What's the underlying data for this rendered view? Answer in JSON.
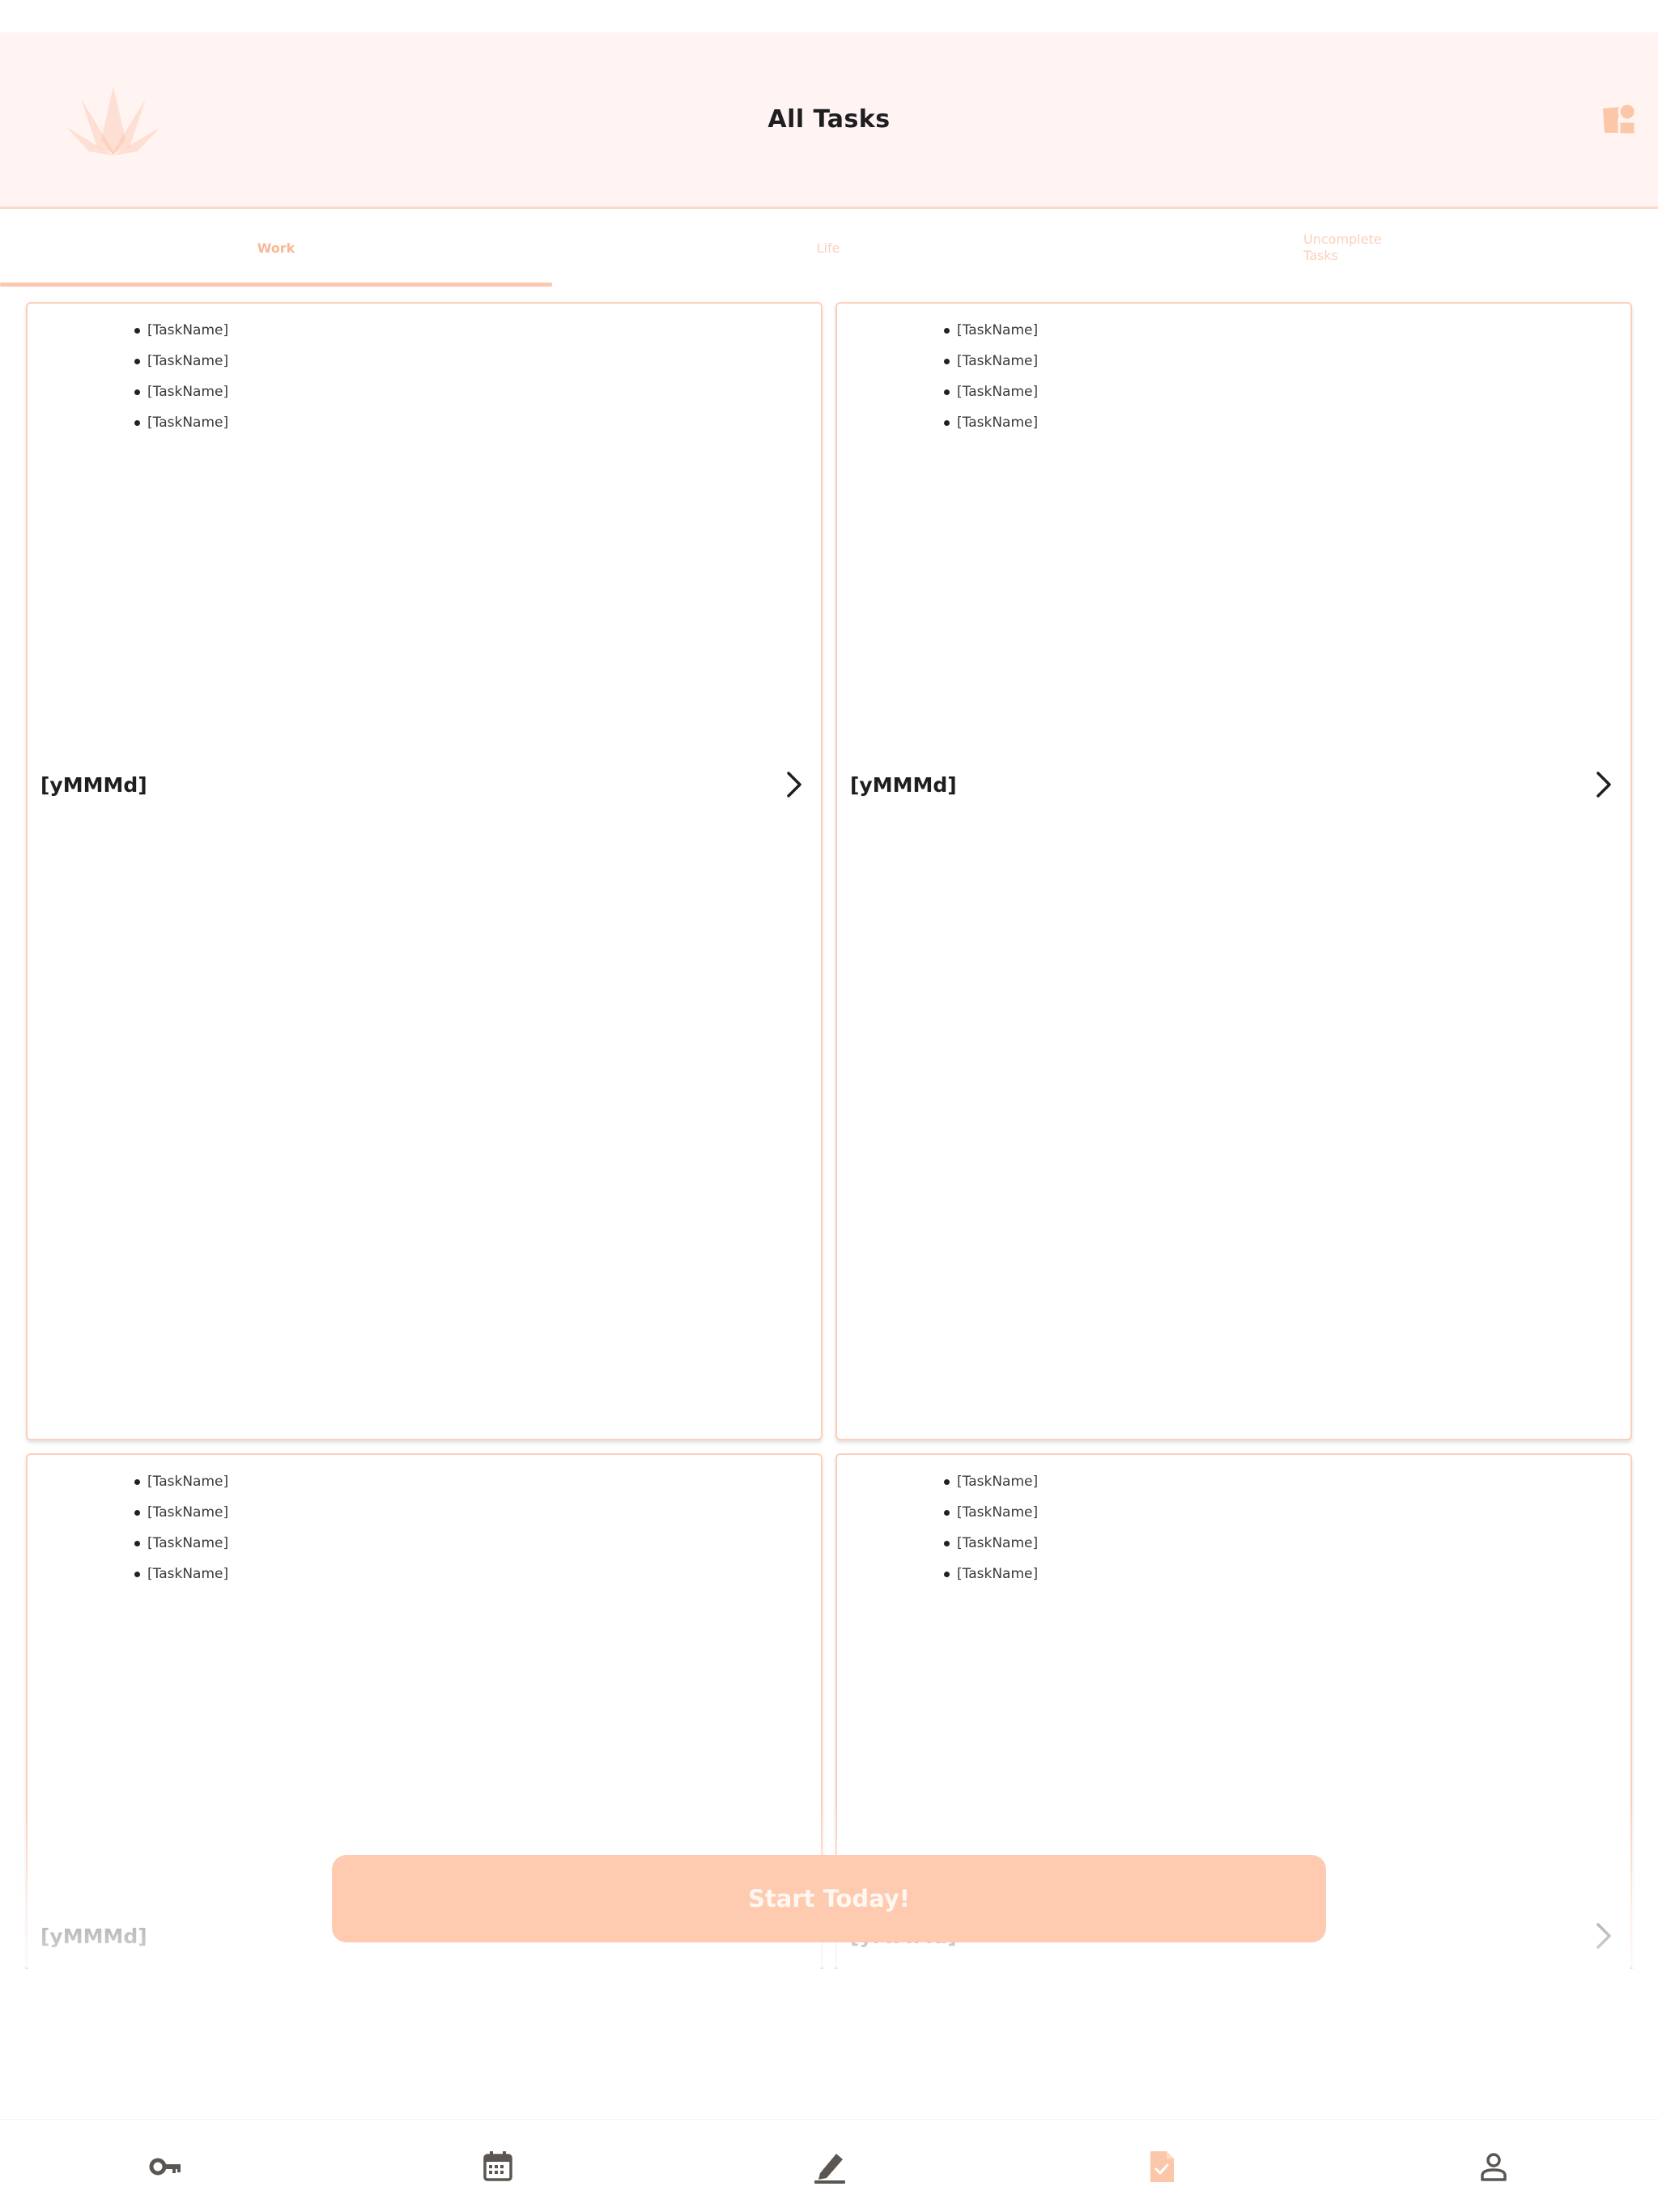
{
  "header": {
    "title": "All Tasks",
    "logo_icon": "lotus-logo-icon",
    "profile_icon": "shapes-icon"
  },
  "tabs": [
    {
      "label": "Work",
      "selected": true
    },
    {
      "label": "Life",
      "selected": false
    },
    {
      "label": "Uncomplete Tasks",
      "selected": false
    }
  ],
  "cards": [
    {
      "tasks": [
        "[TaskName]",
        "[TaskName]",
        "[TaskName]",
        "[TaskName]"
      ],
      "date": "[yMMMd]"
    },
    {
      "tasks": [
        "[TaskName]",
        "[TaskName]",
        "[TaskName]",
        "[TaskName]"
      ],
      "date": "[yMMMd]"
    },
    {
      "tasks": [
        "[TaskName]",
        "[TaskName]",
        "[TaskName]",
        "[TaskName]"
      ],
      "date": "[yMMMd]"
    },
    {
      "tasks": [
        "[TaskName]",
        "[TaskName]",
        "[TaskName]",
        "[TaskName]"
      ],
      "date": "[yMMMd]"
    }
  ],
  "cta": {
    "label": "Start Today!"
  },
  "bottom_nav": [
    {
      "icon": "key-icon",
      "active": false
    },
    {
      "icon": "calendar-icon",
      "active": false
    },
    {
      "icon": "pencil-icon",
      "active": false
    },
    {
      "icon": "task-document-icon",
      "active": true
    },
    {
      "icon": "person-icon",
      "active": false
    }
  ],
  "colors": {
    "accent": "#fecbb0",
    "header_bg": "#fff4f1",
    "tab_text": "#f8b896",
    "nav_icon": "#5b5651",
    "nav_icon_active": "#fcc6a8"
  }
}
